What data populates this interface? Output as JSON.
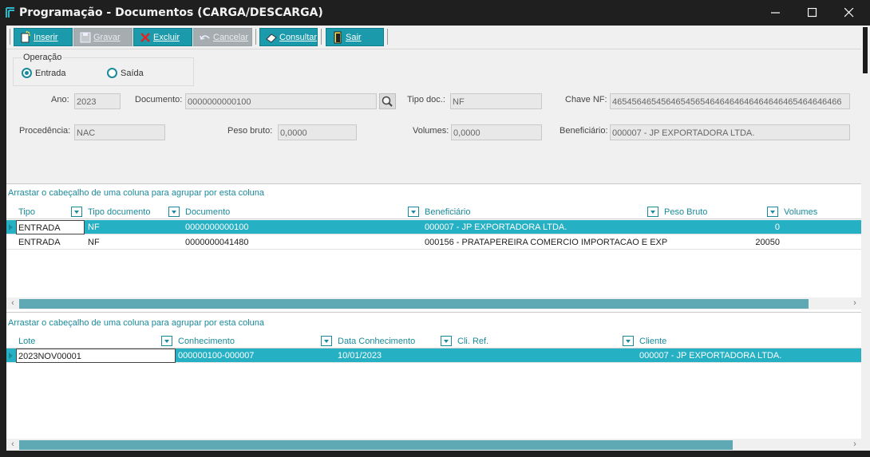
{
  "window": {
    "title": "Programação - Documentos (CARGA/DESCARGA)"
  },
  "toolbar": {
    "insert": "Inserir",
    "save": "Gravar",
    "delete": "Excluir",
    "cancel": "Cancelar",
    "query": "Consultar",
    "exit": "Sair"
  },
  "operation": {
    "title": "Operação",
    "entrada": "Entrada",
    "saida": "Saída",
    "selected": "Entrada"
  },
  "form": {
    "ano_label": "Ano:",
    "ano": "2023",
    "documento_label": "Documento:",
    "documento": "0000000000100",
    "tipo_doc_label": "Tipo doc.:",
    "tipo_doc": "NF",
    "chave_label": "Chave NF:",
    "chave": "46545646545646545654646464646464646465464646466",
    "procedencia_label": "Procedência:",
    "procedencia": "NAC",
    "peso_label": "Peso bruto:",
    "peso": "0,0000",
    "volumes_label": "Volumes:",
    "volumes": "0,0000",
    "beneficiario_label": "Beneficiário:",
    "beneficiario": "000007 - JP EXPORTADORA LTDA."
  },
  "grid1": {
    "hint": "Arrastar o cabeçalho de uma coluna para agrupar por esta coluna",
    "columns": [
      "Tipo",
      "Tipo documento",
      "Documento",
      "Beneficiário",
      "Peso Bruto",
      "Volumes"
    ],
    "rows": [
      [
        "ENTRADA",
        "NF",
        "0000000000100",
        "000007 - JP EXPORTADORA LTDA.",
        "",
        "0"
      ],
      [
        "ENTRADA",
        "NF",
        "0000000041480",
        "000156 - PRATAPEREIRA COMERCIO IMPORTACAO E EXP",
        "",
        "20050"
      ]
    ]
  },
  "grid2": {
    "hint": "Arrastar o cabeçalho de uma coluna para agrupar por esta coluna",
    "columns": [
      "Lote",
      "Conhecimento",
      "Data Conhecimento",
      "Cli. Ref.",
      "Cliente"
    ],
    "rows": [
      [
        "2023NOV00001",
        "000000100-000007",
        "10/01/2023",
        "",
        "000007 - JP EXPORTADORA LTDA."
      ]
    ]
  },
  "colors": {
    "accent": "#1a9aab",
    "selection": "#26b0c3",
    "titlebar": "#1f1f1f"
  }
}
